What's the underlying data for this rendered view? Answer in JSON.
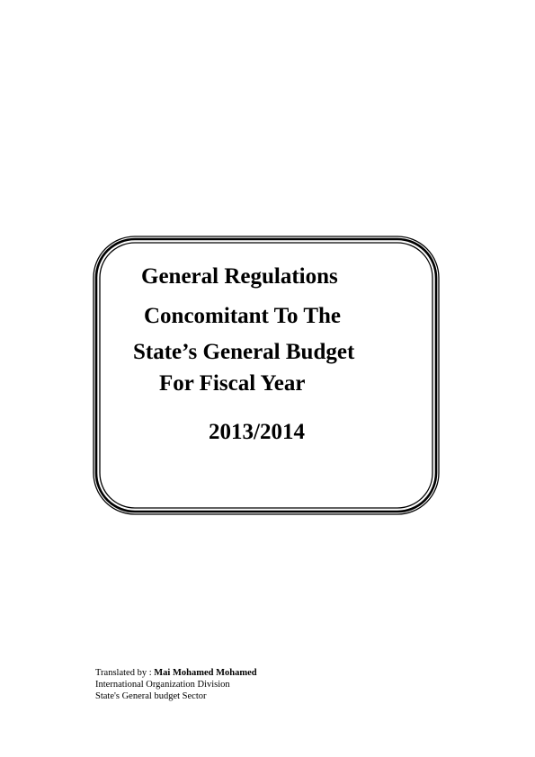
{
  "title": {
    "line1": "General Regulations",
    "line2": "Concomitant To The",
    "line3": "State’s General Budget",
    "line4": "For Fiscal Year",
    "year": "2013/2014"
  },
  "footer": {
    "translated_by_label": "Translated by : ",
    "translator_name": "Mai  Mohamed Mohamed",
    "division": "International Organization Division",
    "sector": "State's General budget Sector"
  }
}
